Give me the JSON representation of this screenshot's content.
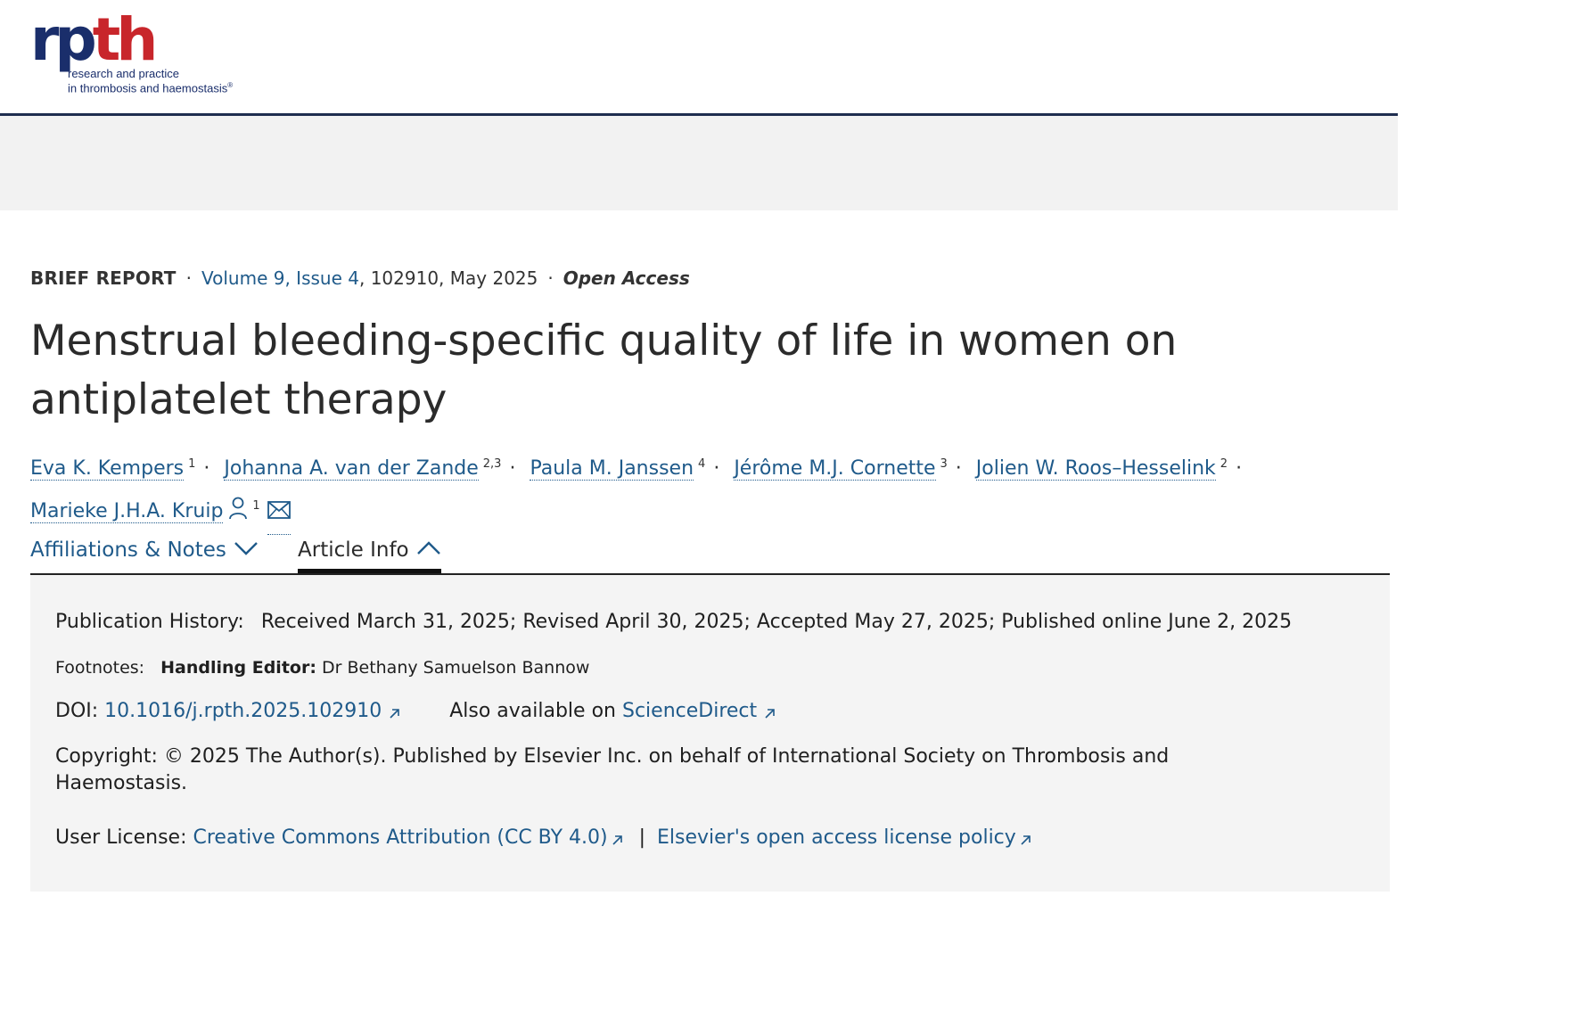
{
  "logo": {
    "mark_rp": "rp",
    "mark_th": "th",
    "tagline_1": "research and practice",
    "tagline_2": "in thrombosis and haemostasis",
    "registered": "®"
  },
  "meta": {
    "article_type": "BRIEF REPORT",
    "volume_label": "Volume 9, Issue 4",
    "article_number_date": ", 102910, May 2025",
    "open_access": "Open Access"
  },
  "title": "Menstrual bleeding-specific quality of life in women on antiplatelet therapy",
  "authors": [
    {
      "name": "Eva K. Kempers",
      "affiliations": "1"
    },
    {
      "name": "Johanna A. van der Zande",
      "affiliations": "2,3"
    },
    {
      "name": "Paula M. Janssen",
      "affiliations": "4"
    },
    {
      "name": "Jérôme M.J. Cornette",
      "affiliations": "3"
    },
    {
      "name": "Jolien W. Roos–Hesselink",
      "affiliations": "2"
    },
    {
      "name": "Marieke J.H.A. Kruip",
      "affiliations": "1"
    }
  ],
  "icons": {
    "corresponding": "person-icon",
    "email": "mail-icon",
    "expand": "chevron-down-icon",
    "collapse": "chevron-up-icon",
    "external": "external-link-icon"
  },
  "tabs": {
    "affiliations": "Affiliations & Notes",
    "article_info": "Article Info"
  },
  "article_info": {
    "history_label": "Publication History:",
    "history_value": "Received March 31, 2025; Revised April 30, 2025; Accepted May 27, 2025; Published online June 2, 2025",
    "footnotes_label": "Footnotes:",
    "handling_editor_label": "Handling Editor:",
    "handling_editor_value": "Dr Bethany Samuelson Bannow",
    "doi_label": "DOI:",
    "doi_value": "10.1016/j.rpth.2025.102910",
    "also_available_label": "Also available on",
    "also_available_link": "ScienceDirect",
    "copyright_label": "Copyright:",
    "copyright_value": "© 2025 The Author(s). Published by Elsevier Inc. on behalf of International Society on Thrombosis and Haemostasis.",
    "license_label": "User License:",
    "license_link": "Creative Commons Attribution (CC BY 4.0)",
    "license_separator": "|",
    "policy_link": "Elsevier's open access license policy"
  },
  "colors": {
    "brand_navy": "#1a2e6b",
    "brand_red": "#c8262b",
    "link": "#1f5a8a",
    "panel_bg": "#f4f4f4",
    "ad_band_bg": "#f2f2f2"
  }
}
